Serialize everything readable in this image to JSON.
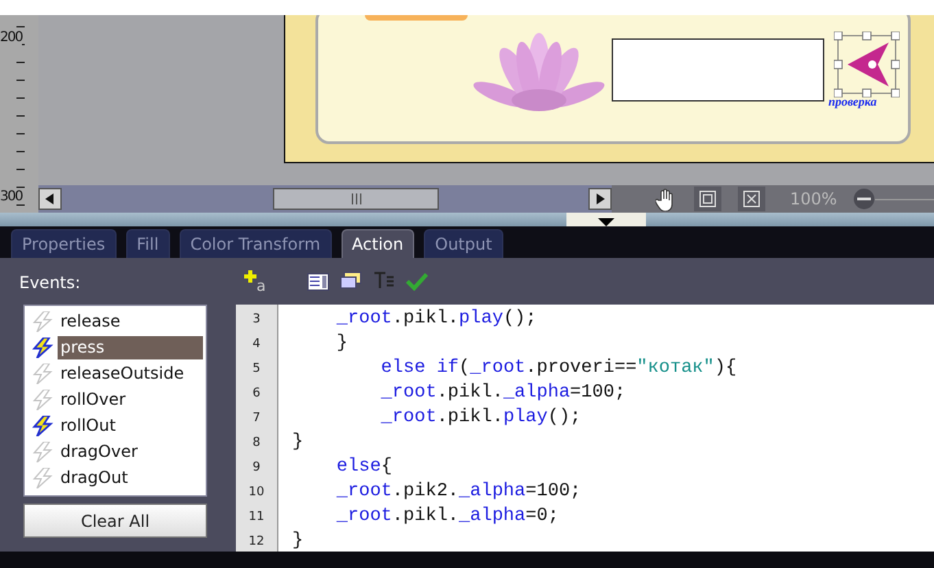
{
  "ruler": {
    "labels": [
      "200",
      "300"
    ]
  },
  "stage": {
    "button_caption": "проверка"
  },
  "view_bar": {
    "zoom": "100%"
  },
  "tabs": [
    {
      "label": "Properties",
      "selected": false
    },
    {
      "label": "Fill",
      "selected": false
    },
    {
      "label": "Color Transform",
      "selected": false
    },
    {
      "label": "Action",
      "selected": true
    },
    {
      "label": "Output",
      "selected": false
    }
  ],
  "events_label": "Events:",
  "toolbar": {
    "add_subscript": "a"
  },
  "events": [
    {
      "label": "release",
      "on": false,
      "selected": false
    },
    {
      "label": "press",
      "on": true,
      "selected": true
    },
    {
      "label": "releaseOutside",
      "on": false,
      "selected": false
    },
    {
      "label": "rollOver",
      "on": false,
      "selected": false
    },
    {
      "label": "rollOut",
      "on": true,
      "selected": false
    },
    {
      "label": "dragOver",
      "on": false,
      "selected": false
    },
    {
      "label": "dragOut",
      "on": false,
      "selected": false
    }
  ],
  "clear_button": "Clear All",
  "code": {
    "lines": [
      {
        "number": "3",
        "tokens": [
          {
            "kind": "keyword",
            "text": "    _root"
          },
          {
            "kind": "plain",
            "text": ".pikl."
          },
          {
            "kind": "keyword",
            "text": "play"
          },
          {
            "kind": "plain",
            "text": "();"
          }
        ]
      },
      {
        "number": "4",
        "tokens": [
          {
            "kind": "plain",
            "text": "    }"
          }
        ]
      },
      {
        "number": "5",
        "tokens": [
          {
            "kind": "keyword",
            "text": "        else if"
          },
          {
            "kind": "plain",
            "text": "("
          },
          {
            "kind": "keyword",
            "text": "_root"
          },
          {
            "kind": "plain",
            "text": ".proveri=="
          },
          {
            "kind": "string",
            "text": "\"котак\""
          },
          {
            "kind": "plain",
            "text": "){"
          }
        ]
      },
      {
        "number": "6",
        "tokens": [
          {
            "kind": "keyword",
            "text": "        _root"
          },
          {
            "kind": "plain",
            "text": ".pikl."
          },
          {
            "kind": "keyword",
            "text": "_alpha"
          },
          {
            "kind": "plain",
            "text": "=100;"
          }
        ]
      },
      {
        "number": "7",
        "tokens": [
          {
            "kind": "keyword",
            "text": "        _root"
          },
          {
            "kind": "plain",
            "text": ".pikl."
          },
          {
            "kind": "keyword",
            "text": "play"
          },
          {
            "kind": "plain",
            "text": "();"
          }
        ]
      },
      {
        "number": "8",
        "tokens": [
          {
            "kind": "plain",
            "text": "}"
          }
        ]
      },
      {
        "number": "9",
        "tokens": [
          {
            "kind": "keyword",
            "text": "    else"
          },
          {
            "kind": "plain",
            "text": "{"
          }
        ]
      },
      {
        "number": "10",
        "tokens": [
          {
            "kind": "keyword",
            "text": "    _root"
          },
          {
            "kind": "plain",
            "text": ".pik2."
          },
          {
            "kind": "keyword",
            "text": "_alpha"
          },
          {
            "kind": "plain",
            "text": "=100;"
          }
        ]
      },
      {
        "number": "11",
        "tokens": [
          {
            "kind": "keyword",
            "text": "    _root"
          },
          {
            "kind": "plain",
            "text": ".pikl."
          },
          {
            "kind": "keyword",
            "text": "_alpha"
          },
          {
            "kind": "plain",
            "text": "=0;"
          }
        ]
      },
      {
        "number": "12",
        "tokens": [
          {
            "kind": "plain",
            "text": "}"
          }
        ]
      }
    ]
  }
}
